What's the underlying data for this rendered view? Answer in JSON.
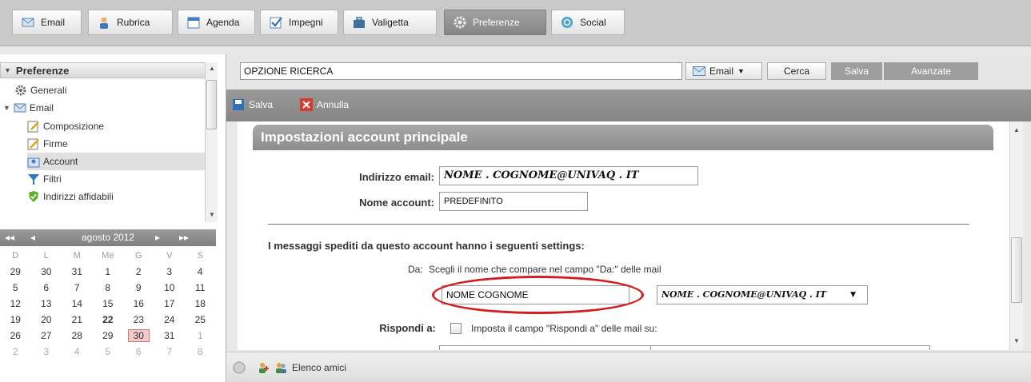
{
  "tabs": [
    {
      "label": "Email",
      "icon": "envelope-icon"
    },
    {
      "label": "Rubrica",
      "icon": "contacts-icon"
    },
    {
      "label": "Agenda",
      "icon": "calendar-icon"
    },
    {
      "label": "Impegni",
      "icon": "tasks-icon"
    },
    {
      "label": "Valigetta",
      "icon": "briefcase-icon"
    },
    {
      "label": "Preferenze",
      "icon": "gear-icon",
      "active": true
    },
    {
      "label": "Social",
      "icon": "social-icon"
    }
  ],
  "sidebar": {
    "title": "Preferenze",
    "items": [
      {
        "label": "Generali",
        "icon": "gear-icon"
      },
      {
        "label": "Email",
        "icon": "envelope-icon"
      },
      {
        "label": "Composizione",
        "icon": "compose-icon"
      },
      {
        "label": "Firme",
        "icon": "signature-icon"
      },
      {
        "label": "Account",
        "icon": "account-icon",
        "selected": true
      },
      {
        "label": "Filtri",
        "icon": "filter-icon"
      },
      {
        "label": "Indirizzi affidabili",
        "icon": "shield-icon"
      }
    ]
  },
  "calendar": {
    "month_label": "agosto 2012",
    "nav": {
      "prev_year": "◂◂",
      "prev_month": "◂",
      "next_month": "▸",
      "next_year": "▸▸"
    },
    "day_headers": [
      "D",
      "L",
      "M",
      "Me",
      "G",
      "V",
      "S"
    ],
    "weeks": [
      [
        "29",
        "30",
        "31",
        "1",
        "2",
        "3",
        "4"
      ],
      [
        "5",
        "6",
        "7",
        "8",
        "9",
        "10",
        "11"
      ],
      [
        "12",
        "13",
        "14",
        "15",
        "16",
        "17",
        "18"
      ],
      [
        "19",
        "20",
        "21",
        "22",
        "23",
        "24",
        "25"
      ],
      [
        "26",
        "27",
        "28",
        "29",
        "30",
        "31",
        "1"
      ],
      [
        "2",
        "3",
        "4",
        "5",
        "6",
        "7",
        "8"
      ]
    ],
    "today": "30"
  },
  "search": {
    "value": "OPZIONE RICERCA",
    "scope": "Email",
    "search_button": "Cerca",
    "save_button": "Salva",
    "advanced_button": "Avanzate"
  },
  "toolbar": {
    "save": "Salva",
    "cancel": "Annulla"
  },
  "form": {
    "section_title": "Impostazioni account principale",
    "email_label": "Indirizzo email:",
    "email_value": "NOME . COGNOME@UNIVAQ . IT",
    "account_name_label": "Nome account:",
    "account_name_value": "PREDEFINITO",
    "sent_settings_heading": "I messaggi spediti da questo account hanno i seguenti settings:",
    "from_label": "Da:",
    "from_hint": "Scegli il nome che compare nel campo \"Da:\" delle mail",
    "from_name_value": "NOME COGNOME",
    "from_address_value": "NOME . COGNOME@UNIVAQ . IT",
    "reply_to_label": "Rispondi a:",
    "reply_to_text": "Imposta il campo \"Rispondi a\" delle mail su:"
  },
  "status": {
    "friends_label": "Elenco amici"
  },
  "colors": {
    "accent_gray": "#8c8c8c",
    "highlight_red": "#d21e1e"
  }
}
